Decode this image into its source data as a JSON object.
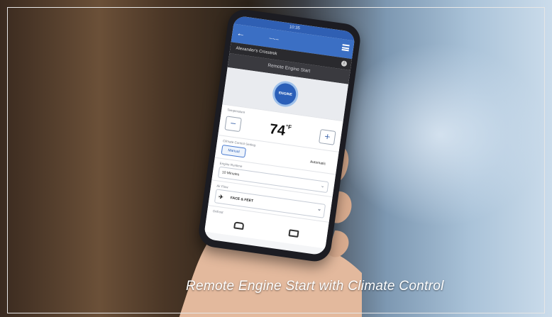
{
  "caption": "Remote Engine Start with Climate Control",
  "phone": {
    "status_time": "10:35",
    "vehicle_name": "Alexander's Crosstrek",
    "screen_title": "Remote Engine Start",
    "start_button_label": "ENGINE START",
    "temperature_label": "Temperature",
    "temperature_value": "74",
    "temperature_unit": "°F",
    "minus_label": "−",
    "plus_label": "+",
    "mode_label": "Climate Control Setting",
    "modes": [
      "Manual",
      "Automatic"
    ],
    "selected_mode": "Manual",
    "runtime_label": "Engine Runtime",
    "runtime_value": "10 Minutes",
    "airflow_label": "Air Flow",
    "airflow_value": "FACE & FEET",
    "defrost_label": "Defrost"
  },
  "colors": {
    "app_blue": "#3b6fc4",
    "caption_text": "#ffffff"
  }
}
